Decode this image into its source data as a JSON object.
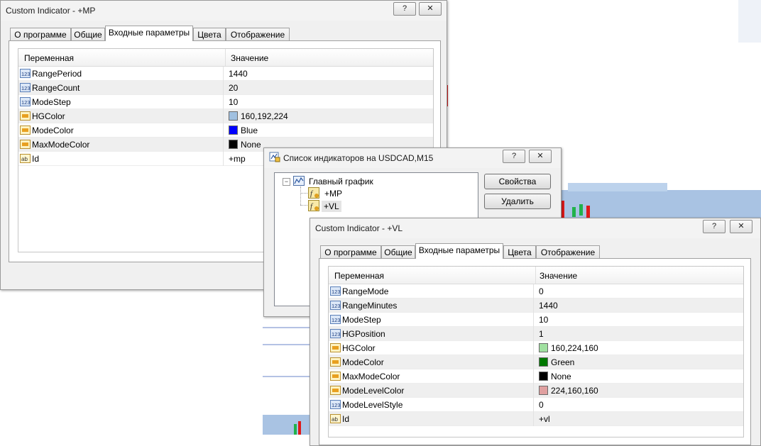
{
  "colors": {
    "chart_line": "#6a86c8",
    "bull": "#21b24b",
    "bear": "#e01919",
    "profile": "#a9c3e3",
    "hg_mp": "#a0c0e0",
    "blue": "#0000ff",
    "none": "#000000",
    "hg_vl": "#a0e0a0",
    "green": "#007800",
    "level": "#e0a0a0"
  },
  "dlg_mp": {
    "title": "Custom Indicator - +MP",
    "help_button": "?",
    "close_button": "✕",
    "tabs": [
      "О программе",
      "Общие",
      "Входные параметры",
      "Цвета",
      "Отображение"
    ],
    "active_tab": 2,
    "col_var": "Переменная",
    "col_val": "Значение",
    "params": [
      {
        "icon": "int-icon",
        "name": "RangePeriod",
        "value": "1440"
      },
      {
        "icon": "int-icon",
        "name": "RangeCount",
        "value": "20"
      },
      {
        "icon": "int-icon",
        "name": "ModeStep",
        "value": "10"
      },
      {
        "icon": "color-icon",
        "name": "HGColor",
        "value": "160,192,224",
        "swatch": "#a0c0e0"
      },
      {
        "icon": "color-icon",
        "name": "ModeColor",
        "value": "Blue",
        "swatch": "#0000ff"
      },
      {
        "icon": "color-icon",
        "name": "MaxModeColor",
        "value": "None",
        "swatch": "#000000"
      },
      {
        "icon": "string-icon",
        "name": "Id",
        "value": "+mp"
      }
    ]
  },
  "dlg_list": {
    "title": "Список индикаторов на USDCAD,M15",
    "help_button": "?",
    "close_button": "✕",
    "tree_root": "Главный график",
    "tree_items": [
      "+MP",
      "+VL"
    ],
    "properties_button": "Свойства",
    "delete_button": "Удалить"
  },
  "dlg_vl": {
    "title": "Custom Indicator - +VL",
    "help_button": "?",
    "close_button": "✕",
    "tabs": [
      "О программе",
      "Общие",
      "Входные параметры",
      "Цвета",
      "Отображение"
    ],
    "active_tab": 2,
    "col_var": "Переменная",
    "col_val": "Значение",
    "params": [
      {
        "icon": "int-icon",
        "name": "RangeMode",
        "value": "0"
      },
      {
        "icon": "int-icon",
        "name": "RangeMinutes",
        "value": "1440"
      },
      {
        "icon": "int-icon",
        "name": "ModeStep",
        "value": "10"
      },
      {
        "icon": "int-icon",
        "name": "HGPosition",
        "value": "1"
      },
      {
        "icon": "color-icon",
        "name": "HGColor",
        "value": "160,224,160",
        "swatch": "#a0e0a0"
      },
      {
        "icon": "color-icon",
        "name": "ModeColor",
        "value": "Green",
        "swatch": "#007800"
      },
      {
        "icon": "color-icon",
        "name": "MaxModeColor",
        "value": "None",
        "swatch": "#000000"
      },
      {
        "icon": "color-icon",
        "name": "ModeLevelColor",
        "value": "224,160,160",
        "swatch": "#e0a0a0"
      },
      {
        "icon": "int-icon",
        "name": "ModeLevelStyle",
        "value": "0"
      },
      {
        "icon": "string-icon",
        "name": "Id",
        "value": "+vl"
      }
    ]
  }
}
